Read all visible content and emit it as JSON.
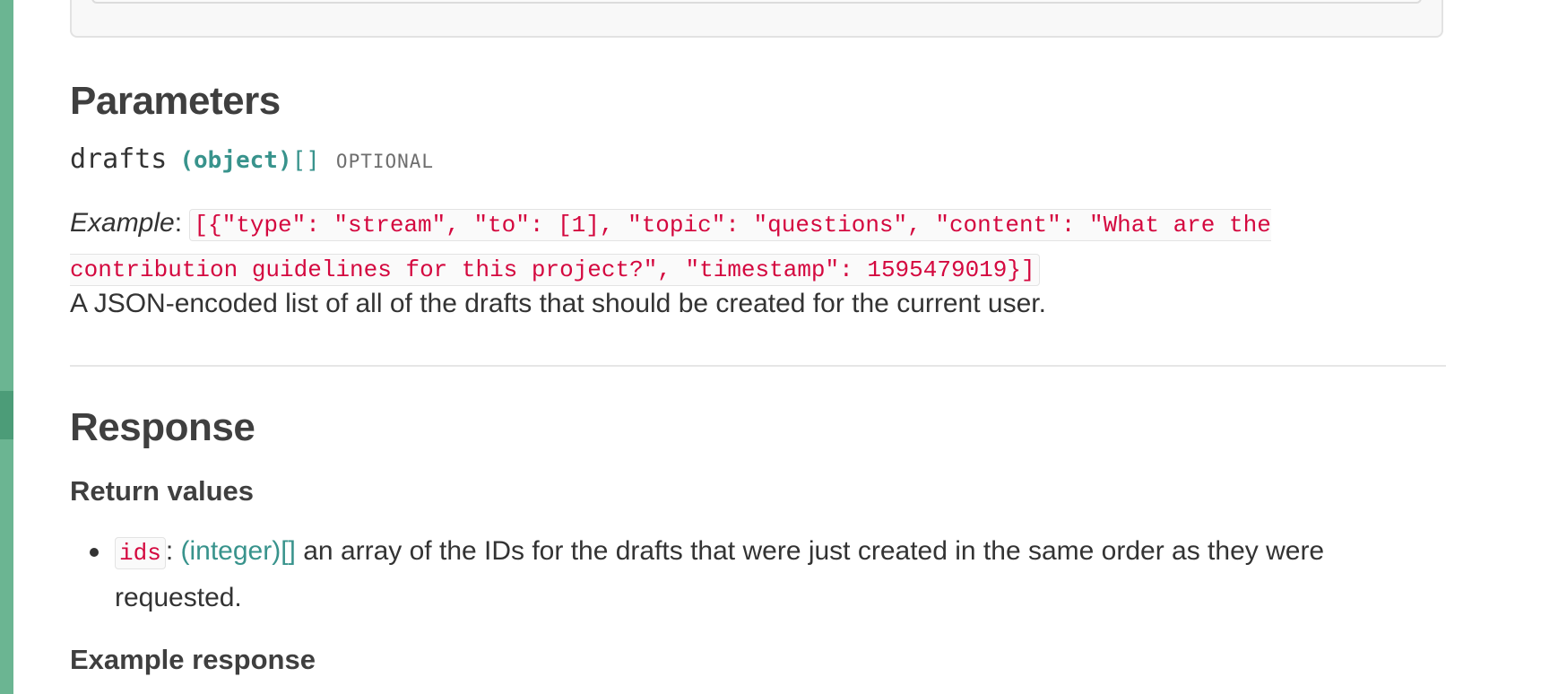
{
  "colors": {
    "rail": "#6bb592",
    "rail_marker": "#4c9c78",
    "type_accent": "#38938c",
    "code_text": "#d4083f",
    "heading": "#3f3f3f"
  },
  "parameters": {
    "heading": "Parameters",
    "param": {
      "name": "drafts",
      "type": "(object)",
      "type_suffix": "[]",
      "flag": "OPTIONAL",
      "example_label": "Example",
      "example_sep": ":",
      "example_value": "[{\"type\": \"stream\", \"to\": [1], \"topic\": \"questions\", \"content\": \"What are the contribution guidelines for this project?\", \"timestamp\": 1595479019}]",
      "description": "A JSON-encoded list of all of the drafts that should be created for the current user."
    }
  },
  "response": {
    "heading": "Response",
    "return_values_heading": "Return values",
    "items": [
      {
        "name": "ids",
        "sep": ":",
        "type": "(integer)[]",
        "description": "an array of the IDs for the drafts that were just created in the same order as they were requested."
      }
    ],
    "example_heading": "Example response"
  }
}
